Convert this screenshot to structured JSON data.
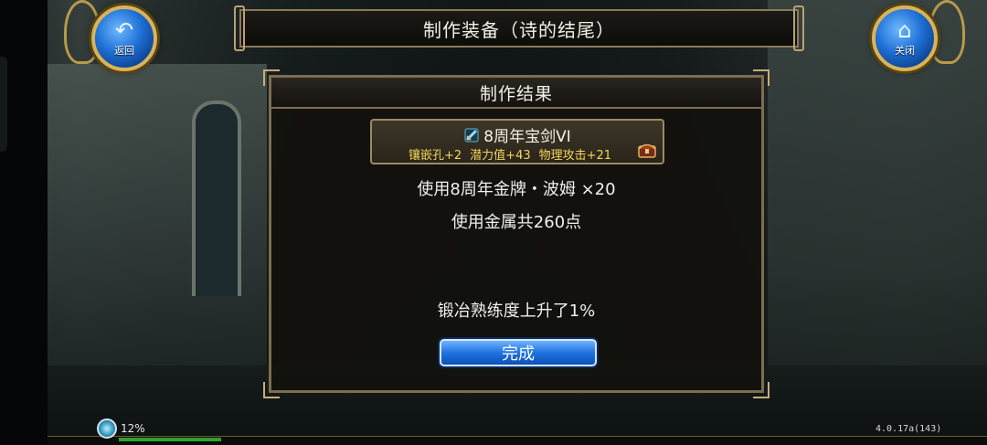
{
  "header": {
    "title": "制作装备（诗的结尾）"
  },
  "back_button": {
    "label": "返回",
    "icon": "back-arrow-icon"
  },
  "close_button": {
    "label": "关闭",
    "icon": "home-icon"
  },
  "dialog": {
    "title": "制作结果",
    "item": {
      "name": "8周年宝剑VI",
      "icon": "sword-icon",
      "stats": [
        "镶嵌孔+2",
        "潜力值+43",
        "物理攻击+21"
      ],
      "badge_icon": "treasure-chest-icon"
    },
    "cost_line_1": "使用8周年金牌・波姆 ×20",
    "cost_line_2": "使用金属共260点",
    "skill_line": "锻冶熟练度上升了1%",
    "confirm_label": "完成"
  },
  "status": {
    "exp_percent": "12%",
    "exp_fraction": 0.12,
    "version": "4.0.17a(143)"
  },
  "colors": {
    "stat_text": "#f4d65a",
    "button_blue": "#1f73e0",
    "frame_gold": "#c7ad78"
  }
}
